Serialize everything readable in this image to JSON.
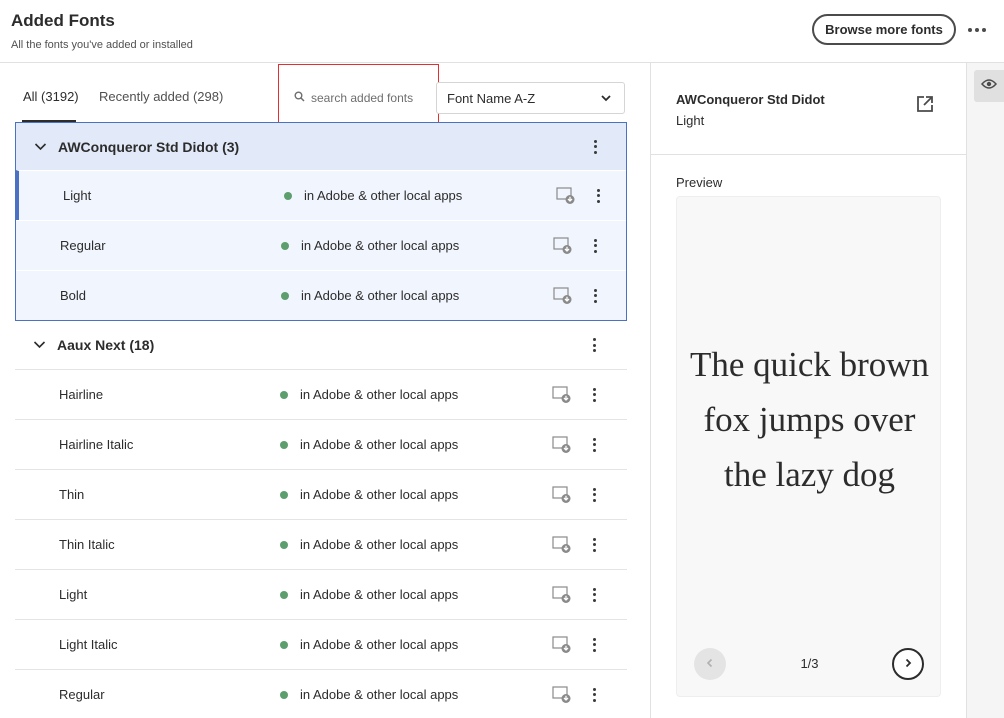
{
  "header": {
    "title": "Added Fonts",
    "subtitle": "All the fonts you've added or installed",
    "browse_label": "Browse more fonts",
    "more_icon": "more-horizontal-icon"
  },
  "tabs": [
    {
      "label": "All (3192)",
      "active": true
    },
    {
      "label": "Recently added (298)",
      "active": false
    }
  ],
  "search": {
    "placeholder": "search added fonts"
  },
  "sort": {
    "value": "Font Name A-Z"
  },
  "families": [
    {
      "name": "AWConqueror Std Didot (3)",
      "expanded": true,
      "selected": true,
      "styles": [
        {
          "name": "Light",
          "status": "in Adobe & other local apps"
        },
        {
          "name": "Regular",
          "status": "in Adobe & other local apps"
        },
        {
          "name": "Bold",
          "status": "in Adobe & other local apps"
        }
      ]
    },
    {
      "name": "Aaux Next (18)",
      "expanded": true,
      "selected": false,
      "styles": [
        {
          "name": "Hairline",
          "status": "in Adobe & other local apps"
        },
        {
          "name": "Hairline Italic",
          "status": "in Adobe & other local apps"
        },
        {
          "name": "Thin",
          "status": "in Adobe & other local apps"
        },
        {
          "name": "Thin Italic",
          "status": "in Adobe & other local apps"
        },
        {
          "name": "Light",
          "status": "in Adobe & other local apps"
        },
        {
          "name": "Light Italic",
          "status": "in Adobe & other local apps"
        },
        {
          "name": "Regular",
          "status": "in Adobe & other local apps"
        }
      ]
    }
  ],
  "detail": {
    "font_name": "AWConqueror Std Didot",
    "font_style": "Light",
    "preview_label": "Preview",
    "preview_text": "The quick brown fox jumps over the lazy dog",
    "pager": "1/3"
  },
  "colors": {
    "accent": "#4b72c2",
    "status_active": "#5c9e6e",
    "selected_bg": "#e2e9f8",
    "highlight_box": "#e03030"
  }
}
